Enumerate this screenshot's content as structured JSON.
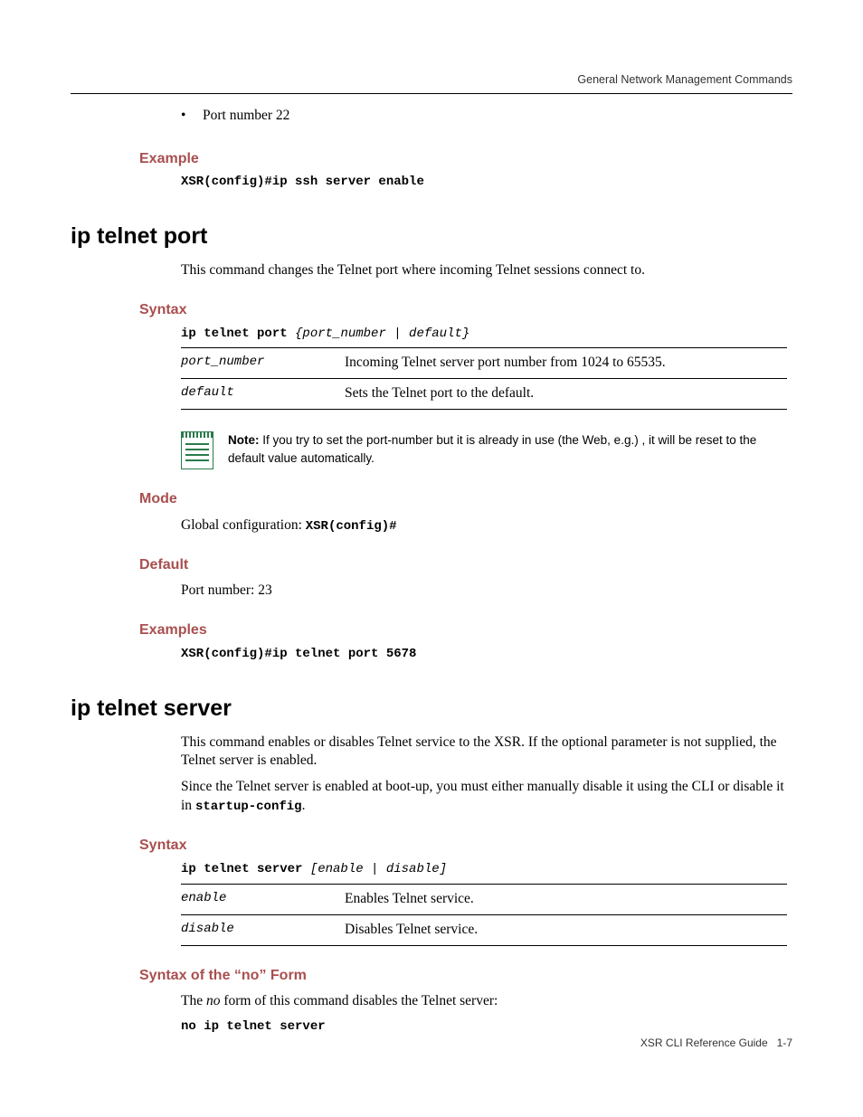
{
  "header": {
    "title": "General Network Management Commands"
  },
  "top_bullet": {
    "text": "Port number 22"
  },
  "example1": {
    "heading": "Example",
    "code": "XSR(config)#ip ssh server enable"
  },
  "cmd1": {
    "title": "ip telnet port",
    "description": "This command changes the Telnet port where incoming Telnet sessions connect to.",
    "syntax_heading": "Syntax",
    "syntax_prefix": "ip telnet port ",
    "syntax_args": "{port_number | default}",
    "params": [
      {
        "key": "port_number",
        "desc": "Incoming Telnet server port number from 1024 to 65535."
      },
      {
        "key": "default",
        "desc": "Sets the Telnet port to the default."
      }
    ],
    "note_label": "Note:",
    "note_text": " If you try to set the port-number but it is already in use (the Web, e.g.) , it will be reset to the default value automatically.",
    "mode_heading": "Mode",
    "mode_text": "Global configuration: ",
    "mode_code": "XSR(config)#",
    "default_heading": "Default",
    "default_text": "Port number: 23",
    "examples_heading": "Examples",
    "examples_code": "XSR(config)#ip telnet port 5678"
  },
  "cmd2": {
    "title": "ip telnet server",
    "description1": "This command enables or disables Telnet service to the XSR. If the optional parameter is not supplied, the Telnet server is enabled.",
    "description2a": "Since the Telnet server is enabled at boot-up, you must either manually disable it using the CLI or disable it in ",
    "description2code": "startup-config",
    "description2b": ".",
    "syntax_heading": "Syntax",
    "syntax_prefix": "ip telnet server ",
    "syntax_args": "[enable | disable]",
    "params": [
      {
        "key": "enable",
        "desc": "Enables Telnet service."
      },
      {
        "key": "disable",
        "desc": "Disables Telnet service."
      }
    ],
    "noform_heading": "Syntax of the “no” Form",
    "noform_text_a": "The ",
    "noform_text_em": "no",
    "noform_text_b": " form of this command disables the Telnet server:",
    "noform_code": "no ip telnet server"
  },
  "footer": {
    "book": "XSR CLI Reference Guide",
    "page": "1-7"
  }
}
